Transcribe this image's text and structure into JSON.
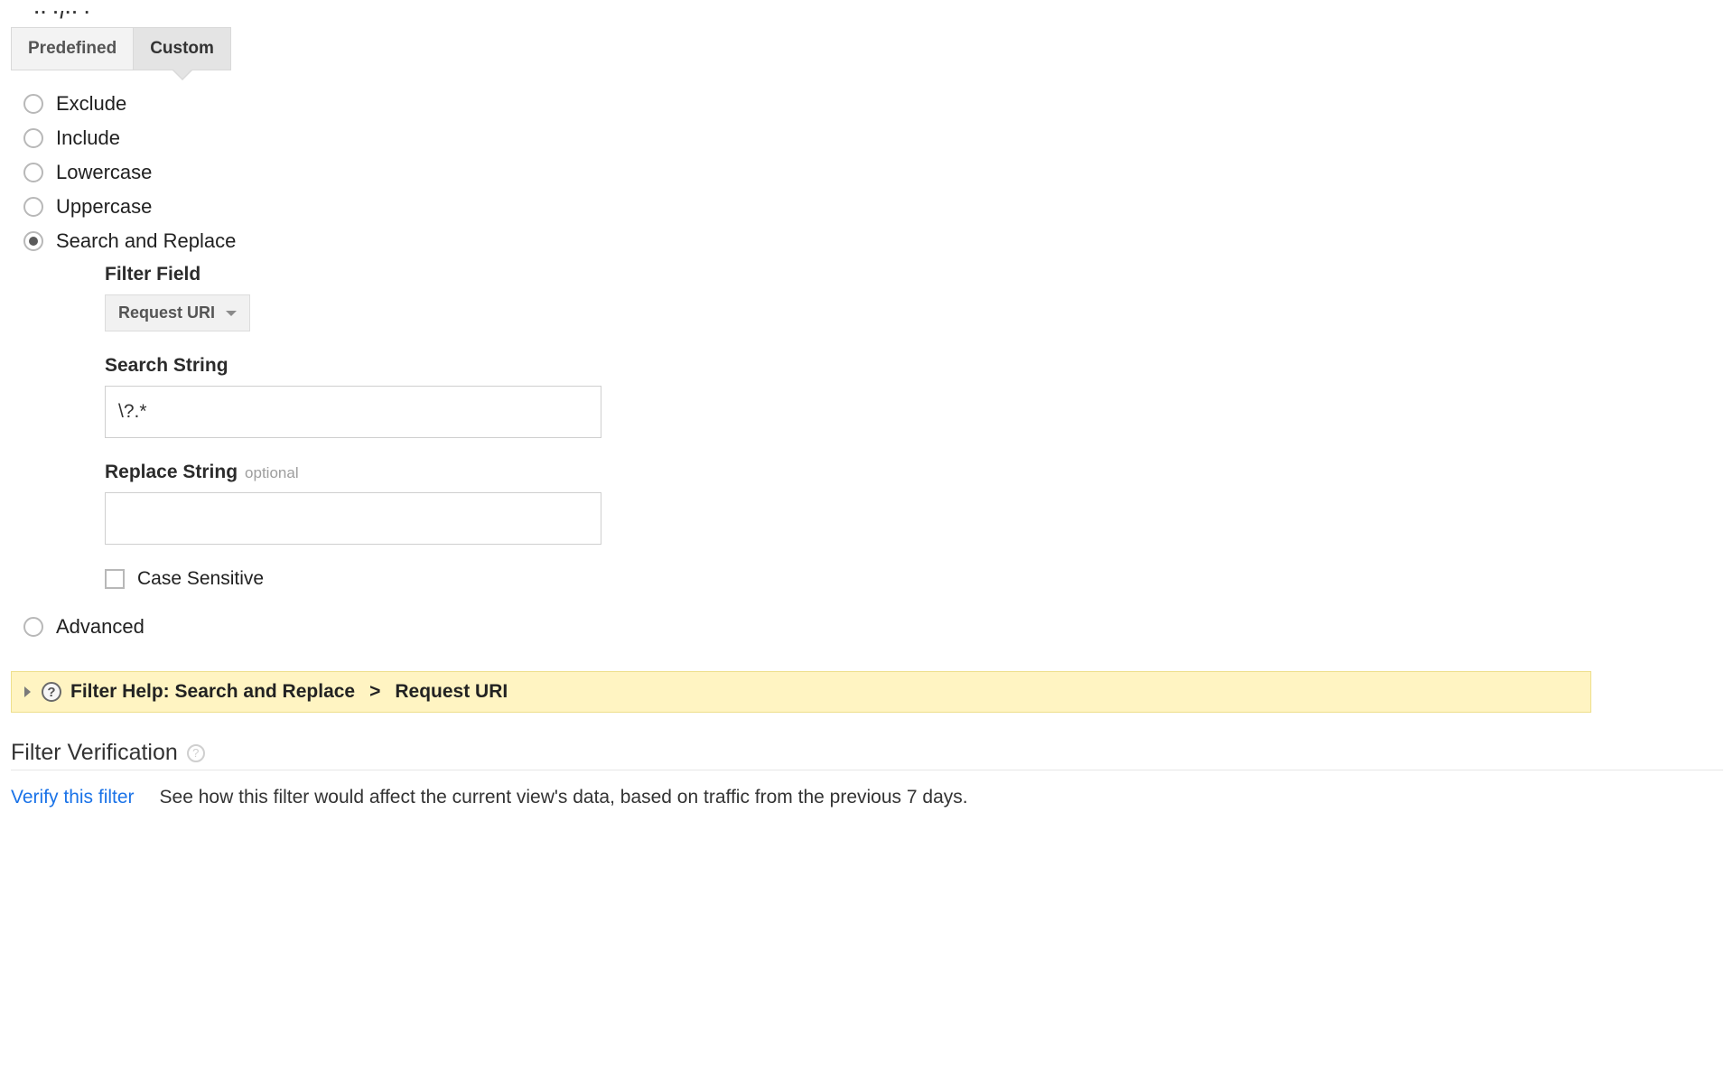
{
  "tabs": {
    "predefined": "Predefined",
    "custom": "Custom"
  },
  "radios": {
    "exclude": "Exclude",
    "include": "Include",
    "lowercase": "Lowercase",
    "uppercase": "Uppercase",
    "search_replace": "Search and Replace",
    "advanced": "Advanced"
  },
  "form": {
    "filter_field_label": "Filter Field",
    "filter_field_value": "Request URI",
    "search_string_label": "Search String",
    "search_string_value": "\\?.*",
    "replace_string_label": "Replace String",
    "replace_string_optional": "optional",
    "replace_string_value": "",
    "case_sensitive_label": "Case Sensitive"
  },
  "help": {
    "prefix": "Filter Help: Search and Replace",
    "separator": ">",
    "subject": "Request URI"
  },
  "verification": {
    "heading": "Filter Verification",
    "link": "Verify this filter",
    "description": "See how this filter would affect the current view's data, based on traffic from the previous 7 days."
  }
}
